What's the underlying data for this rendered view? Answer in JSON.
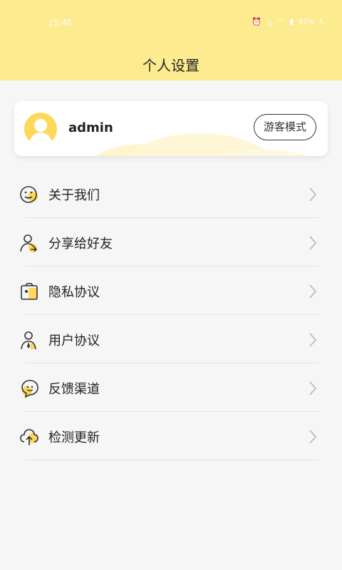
{
  "status_bar": {
    "time": "15:46",
    "battery": "81%"
  },
  "header": {
    "title": "个人设置"
  },
  "profile": {
    "username": "admin",
    "guest_mode_label": "游客模式"
  },
  "menu": [
    {
      "label": "关于我们",
      "icon": "smiley-icon"
    },
    {
      "label": "分享给好友",
      "icon": "share-user-icon"
    },
    {
      "label": "隐私协议",
      "icon": "camera-lock-icon"
    },
    {
      "label": "用户协议",
      "icon": "person-tie-icon"
    },
    {
      "label": "反馈渠道",
      "icon": "feedback-chat-icon"
    },
    {
      "label": "检测更新",
      "icon": "cloud-upload-icon"
    }
  ],
  "colors": {
    "accent": "#fdd85a",
    "header_bg": "#fdeb8f",
    "page_bg": "#f6f6f6"
  }
}
